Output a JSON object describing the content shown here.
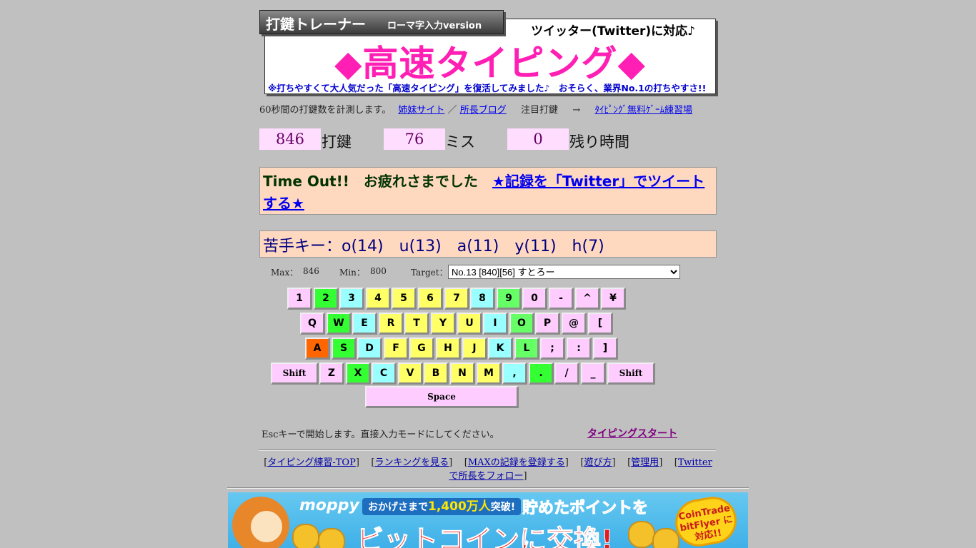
{
  "header": {
    "tab_title": "打鍵トレーナー",
    "tab_subtitle": "ローマ字入力version",
    "twitter_note": "ツイッター(Twitter)に対応♪",
    "main_title": "◆高速タイピング◆",
    "sub_note": "※打ちやすくて大人気だった「高速タイピング」を復活してみました♪　おそらく、業界No.1の打ちやすさ!!"
  },
  "info": {
    "text": "60秒間の打鍵数を計測します。",
    "sister_site": "姉妹サイト",
    "slash": "／",
    "blog": "所長ブログ",
    "featured": "注目打鍵",
    "arrow": "→",
    "game_link": "ﾀｲﾋﾟﾝｸﾞ無料ｹﾞｰﾑ練習場"
  },
  "counters": {
    "keystrokes_value": "846",
    "keystrokes_label": "打鍵",
    "miss_value": "76",
    "miss_label": "ミス",
    "time_value": "0",
    "time_label": "残り時間"
  },
  "result": {
    "message": "Time Out!!　お疲れさまでした　",
    "tweet_link": "★記録を「Twitter」でツイートする★"
  },
  "weak_keys": {
    "label": "苦手キー：o(14)　u(13)　a(11)　y(11)　h(7)"
  },
  "stats": {
    "max_label": "Max：",
    "max_value": "846",
    "min_label": "Min：",
    "min_value": "800",
    "target_label": "Target：",
    "target_selected": "No.13 [840][56] すとろー"
  },
  "keyboard": {
    "rows": [
      [
        {
          "label": "1",
          "color": "#ffccff"
        },
        {
          "label": "2",
          "color": "#33ff33"
        },
        {
          "label": "3",
          "color": "#99ffff"
        },
        {
          "label": "4",
          "color": "#ffff66"
        },
        {
          "label": "5",
          "color": "#ffff66"
        },
        {
          "label": "6",
          "color": "#ffff66"
        },
        {
          "label": "7",
          "color": "#ffff66"
        },
        {
          "label": "8",
          "color": "#99ffff"
        },
        {
          "label": "9",
          "color": "#66ff66"
        },
        {
          "label": "0",
          "color": "#ffccff"
        },
        {
          "label": "-",
          "color": "#ffccff"
        },
        {
          "label": "^",
          "color": "#ffccff"
        },
        {
          "label": "¥",
          "color": "#ffccff"
        }
      ],
      [
        {
          "label": "Q",
          "color": "#ffccff"
        },
        {
          "label": "W",
          "color": "#33ff33"
        },
        {
          "label": "E",
          "color": "#99ffff"
        },
        {
          "label": "R",
          "color": "#ffff66"
        },
        {
          "label": "T",
          "color": "#ffff66"
        },
        {
          "label": "Y",
          "color": "#ffff66"
        },
        {
          "label": "U",
          "color": "#ffff66"
        },
        {
          "label": "I",
          "color": "#99ffff"
        },
        {
          "label": "O",
          "color": "#66ff66"
        },
        {
          "label": "P",
          "color": "#ffccff"
        },
        {
          "label": "@",
          "color": "#ffccff"
        },
        {
          "label": "[",
          "color": "#ffccff"
        }
      ],
      [
        {
          "label": "A",
          "color": "#ff6600"
        },
        {
          "label": "S",
          "color": "#33ff33"
        },
        {
          "label": "D",
          "color": "#99ffff"
        },
        {
          "label": "F",
          "color": "#ffff66"
        },
        {
          "label": "G",
          "color": "#ffff66"
        },
        {
          "label": "H",
          "color": "#ffff66"
        },
        {
          "label": "J",
          "color": "#ffff66"
        },
        {
          "label": "K",
          "color": "#99ffff"
        },
        {
          "label": "L",
          "color": "#66ff66"
        },
        {
          "label": ";",
          "color": "#ffccff"
        },
        {
          "label": ":",
          "color": "#ffccff"
        },
        {
          "label": "]",
          "color": "#ffccff"
        }
      ],
      [
        {
          "label": "Shift",
          "color": "#ffccff"
        },
        {
          "label": "Z",
          "color": "#ffccff"
        },
        {
          "label": "X",
          "color": "#33ff33"
        },
        {
          "label": "C",
          "color": "#99ffff"
        },
        {
          "label": "V",
          "color": "#ffff66"
        },
        {
          "label": "B",
          "color": "#ffff66"
        },
        {
          "label": "N",
          "color": "#ffff66"
        },
        {
          "label": "M",
          "color": "#ffff66"
        },
        {
          "label": ",",
          "color": "#99ffff"
        },
        {
          "label": ".",
          "color": "#33ff33"
        },
        {
          "label": "/",
          "color": "#ffccff"
        },
        {
          "label": "_",
          "color": "#ffccff"
        },
        {
          "label": "Shift",
          "color": "#ffccff"
        }
      ],
      [
        {
          "label": "Space",
          "color": "#ffccff"
        }
      ]
    ]
  },
  "footer": {
    "esc_prefix": "Esc",
    "esc_text": "キーで開始します。直接入力モードにしてください。",
    "start_link": "タイピングスタート",
    "links": [
      {
        "label": "タイピング練習-TOP"
      },
      {
        "label": "ランキングを見る"
      },
      {
        "label": "MAXの記録を登録する"
      },
      {
        "label": "遊び方"
      },
      {
        "label": "管理用"
      },
      {
        "label": "Twitterで所長をフォロー"
      }
    ]
  },
  "banner": {
    "logo": "moppy",
    "pill_prefix": "おかげさまで",
    "pill_highlight": "1,400万人",
    "pill_suffix": "突破!",
    "headline1": "貯めたポイントを",
    "headline2": "ビットコインに交換!",
    "badge": "CoinTrade bitFlyer に対応!!"
  }
}
